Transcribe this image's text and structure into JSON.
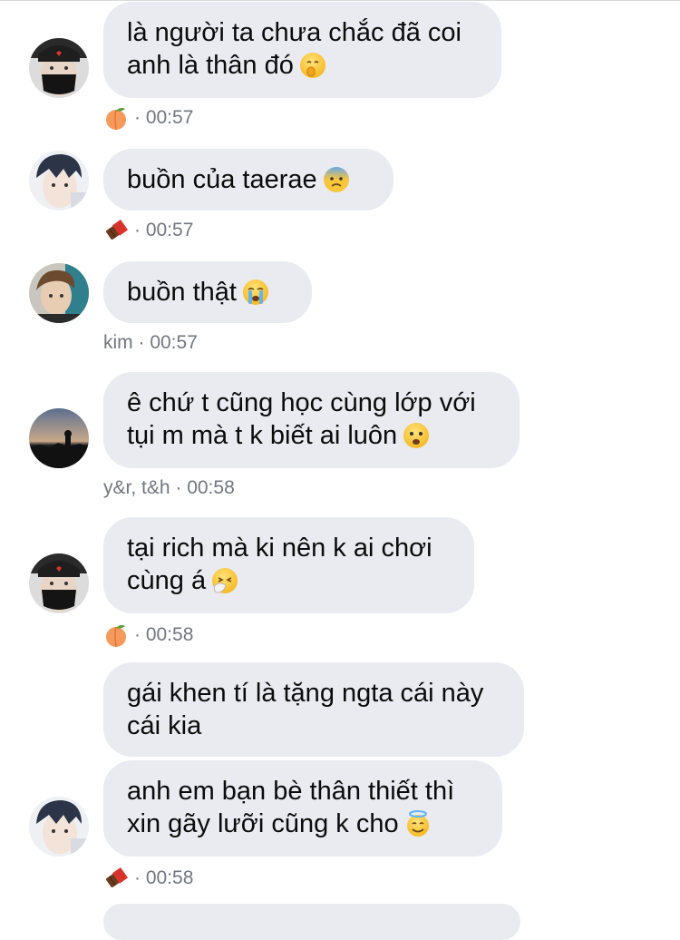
{
  "messages": [
    {
      "lines": [
        "là người ta chưa chắc đã coi",
        "anh là thân đó"
      ],
      "emoji": "shushing-face"
    },
    {
      "lines": [
        "buồn của taerae"
      ],
      "emoji": "anxious-face"
    },
    {
      "lines": [
        "buồn thật"
      ],
      "emoji": "crying-face"
    },
    {
      "lines": [
        "ê chứ t cũng học cùng lớp với",
        "tụi m mà t k biết ai luôn"
      ],
      "emoji": "frowning-face"
    },
    {
      "lines": [
        "tại rich mà ki nên k ai chơi",
        "cùng á"
      ],
      "emoji": "sneezing-face"
    },
    {
      "lines": [
        "gái khen tí là tặng ngta cái này",
        "cái kia"
      ]
    },
    {
      "lines": [
        "anh em bạn bè thân thiết thì",
        "xin gãy lưỡi cũng k cho"
      ],
      "emoji": "smiling-face-with-halo"
    }
  ],
  "meta": [
    {
      "icon": "peach-icon",
      "text": "· 00:57"
    },
    {
      "icon": "chocolate-bar-icon",
      "text": "· 00:57"
    },
    {
      "text": "kim · 00:57"
    },
    {
      "text": "y&r, t&h · 00:58"
    },
    {
      "icon": "peach-icon",
      "text": "· 00:58"
    },
    {
      "icon": "chocolate-bar-icon",
      "text": "· 00:58"
    }
  ],
  "colors": {
    "bubble": "#e9ebf1",
    "meta_text": "#72767e",
    "background": "#ffffff"
  }
}
